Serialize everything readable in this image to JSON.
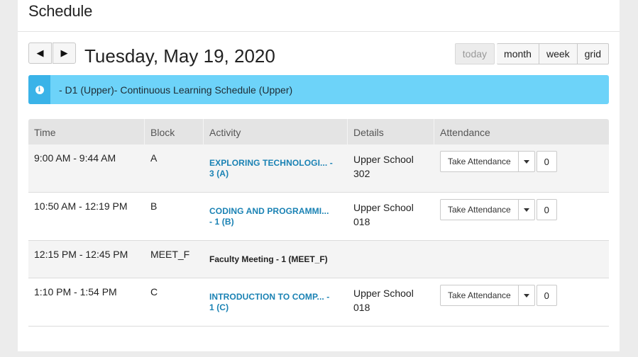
{
  "header": {
    "title": "Schedule"
  },
  "toolbar": {
    "prev_glyph": "◀",
    "next_glyph": "▶",
    "date": "Tuesday, May 19, 2020",
    "views": {
      "today": "today",
      "month": "month",
      "week": "week",
      "grid": "grid"
    }
  },
  "alert": {
    "icon": "info-icon",
    "glyph": "i",
    "text": "- D1 (Upper)- Continuous Learning Schedule (Upper)"
  },
  "table": {
    "headers": {
      "time": "Time",
      "block": "Block",
      "activity": "Activity",
      "details": "Details",
      "attendance": "Attendance"
    },
    "rows": [
      {
        "time": "9:00 AM - 9:44 AM",
        "block": "A",
        "activity_line1": "EXPLORING TECHNOLOGI... -",
        "activity_line2": "3 (A)",
        "details_line1": "Upper School",
        "details_line2": "302",
        "attendance_label": "Take Attendance",
        "count": "0"
      },
      {
        "time": "10:50 AM - 12:19 PM",
        "block": "B",
        "activity_line1": "CODING AND PROGRAMMI...",
        "activity_line2": "- 1 (B)",
        "details_line1": "Upper School",
        "details_line2": "018",
        "attendance_label": "Take Attendance",
        "count": "0"
      },
      {
        "time": "12:15 PM - 12:45 PM",
        "block": "MEET_F",
        "activity": "Faculty Meeting - 1 (MEET_F)"
      },
      {
        "time": "1:10 PM - 1:54 PM",
        "block": "C",
        "activity_line1": "INTRODUCTION TO COMP... -",
        "activity_line2": "1 (C)",
        "details_line1": "Upper School",
        "details_line2": "018",
        "attendance_label": "Take Attendance",
        "count": "0"
      }
    ]
  },
  "colors": {
    "alert_bg": "#6dd3f9",
    "alert_icon_bg": "#3ab3e8",
    "link": "#1a82b4"
  }
}
